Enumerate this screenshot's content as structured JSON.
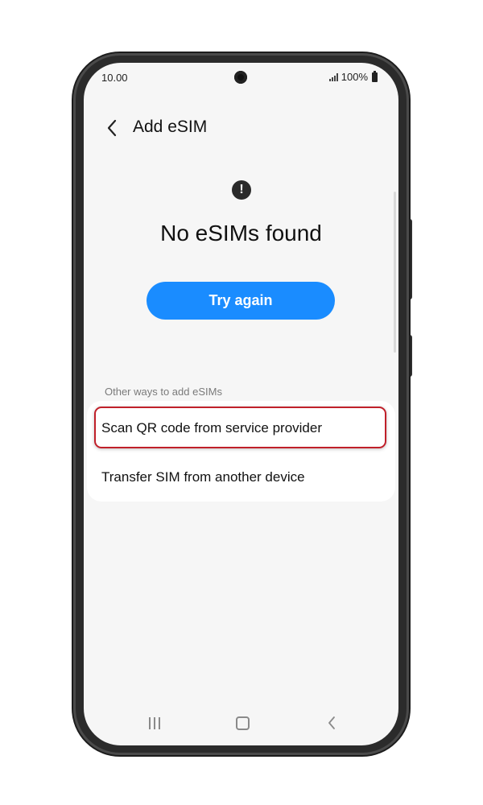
{
  "status_bar": {
    "time": "10.00",
    "battery": "100%"
  },
  "header": {
    "title": "Add eSIM",
    "back_icon": "chevron-left-icon"
  },
  "main": {
    "alert_icon": "exclamation-circle-icon",
    "alert_glyph": "!",
    "headline": "No eSIMs found",
    "try_again_label": "Try again"
  },
  "options": {
    "section_label": "Other ways to add eSIMs",
    "items": [
      {
        "label": "Scan QR code from service provider",
        "highlighted": true
      },
      {
        "label": "Transfer SIM from another device",
        "highlighted": false
      }
    ],
    "highlight_color": "#c0202a"
  },
  "nav_bar": {
    "recents_icon": "recents-icon",
    "home_icon": "home-icon",
    "back_icon": "back-icon"
  },
  "colors": {
    "accent": "#1a8cff",
    "screen_bg": "#f6f6f6",
    "frame": "#2b2b2b"
  }
}
